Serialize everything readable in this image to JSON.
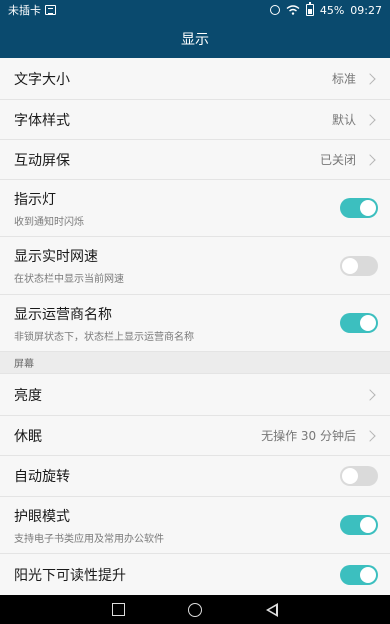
{
  "status_bar": {
    "carrier": "未插卡",
    "battery": "45%",
    "time": "09:27"
  },
  "header": {
    "title": "显示"
  },
  "settings": {
    "font_size": {
      "title": "文字大小",
      "value": "标准"
    },
    "font_style": {
      "title": "字体样式",
      "value": "默认"
    },
    "interactive_screensaver": {
      "title": "互动屏保",
      "value": "已关闭"
    },
    "indicator_light": {
      "title": "指示灯",
      "sub": "收到通知时闪烁",
      "on": true
    },
    "realtime_speed": {
      "title": "显示实时网速",
      "sub": "在状态栏中显示当前网速",
      "on": false
    },
    "carrier_name": {
      "title": "显示运营商名称",
      "sub": "非锁屏状态下，状态栏上显示运营商名称",
      "on": true
    }
  },
  "section_screen": {
    "header": "屏幕",
    "brightness": {
      "title": "亮度"
    },
    "sleep": {
      "title": "休眠",
      "value": "无操作 30 分钟后"
    },
    "auto_rotate": {
      "title": "自动旋转",
      "on": false
    },
    "eye_comfort": {
      "title": "护眼模式",
      "sub": "支持电子书类应用及常用办公软件",
      "on": true
    },
    "sunlight_readability": {
      "title": "阳光下可读性提升",
      "on": true
    }
  },
  "colors": {
    "header_bg": "#0a4a6e",
    "toggle_on": "#3cbfbf",
    "toggle_off": "#dadada"
  }
}
